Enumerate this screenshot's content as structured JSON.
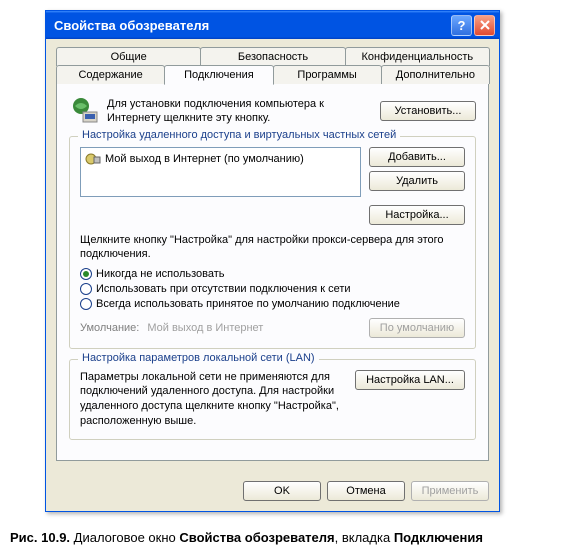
{
  "window": {
    "title": "Свойства обозревателя"
  },
  "tabs": {
    "row1": [
      "Общие",
      "Безопасность",
      "Конфиденциальность"
    ],
    "row2": [
      "Содержание",
      "Подключения",
      "Программы",
      "Дополнительно"
    ],
    "active": "Подключения"
  },
  "setup": {
    "text": "Для установки подключения компьютера к Интернету щелкните эту кнопку.",
    "button": "Установить..."
  },
  "dialGroup": {
    "title": "Настройка удаленного доступа и виртуальных частных сетей",
    "items": [
      {
        "label": "Мой выход в Интернет (по умолчанию)"
      }
    ],
    "addBtn": "Добавить...",
    "removeBtn": "Удалить",
    "settingsBtn": "Настройка...",
    "hint": "Щелкните кнопку \"Настройка\" для настройки прокси-сервера для этого подключения.",
    "radios": {
      "never": "Никогда не использовать",
      "whenNoNet": "Использовать при отсутствии подключения к сети",
      "always": "Всегда использовать принятое по умолчанию подключение"
    },
    "defaultLabel": "Умолчание:",
    "defaultValue": "Мой выход в Интернет",
    "defaultBtn": "По умолчанию"
  },
  "lanGroup": {
    "title": "Настройка параметров локальной сети (LAN)",
    "text": "Параметры локальной сети не применяются для подключений удаленного доступа. Для настройки удаленного доступа щелкните кнопку \"Настройка\", расположенную выше.",
    "button": "Настройка LAN..."
  },
  "footer": {
    "ok": "OK",
    "cancel": "Отмена",
    "apply": "Применить"
  },
  "caption": {
    "prefix": "Рис. 10.9.",
    "mid1": " Диалоговое окно ",
    "b1": "Свойства обозревателя",
    "mid2": ", вкладка ",
    "b2": "Подключения"
  }
}
